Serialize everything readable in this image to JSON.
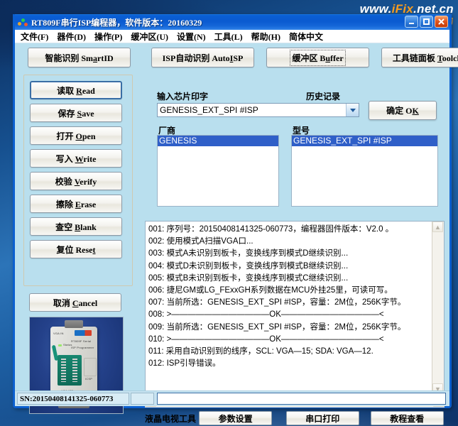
{
  "watermark": {
    "line1_pre": "www.",
    "line1_hl": "iFix",
    "line1_post": ".net.cn",
    "line2": "爱修．助力"
  },
  "window": {
    "title": "RT809F串行ISP编程器，软件版本：20160329",
    "buttons": {
      "minimize": "minimize-icon",
      "maximize": "maximize-icon",
      "close": "close-icon"
    }
  },
  "menu": [
    {
      "label": "文件(F)"
    },
    {
      "label": "器件(D)"
    },
    {
      "label": "操作(P)"
    },
    {
      "label": "缓冲区(U)"
    },
    {
      "label": "设置(N)"
    },
    {
      "label": "工具(L)"
    },
    {
      "label": "帮助(H)"
    },
    {
      "label": "简体中文"
    }
  ],
  "toolbar": [
    {
      "cn": "智能识别 Sm",
      "mn": "a",
      "post": "rtID"
    },
    {
      "cn": "ISP自动识别 Auto",
      "mn": "I",
      "post": "SP"
    },
    {
      "cn": "缓冲区 B",
      "mn": "u",
      "post": "ffer",
      "focused": true
    },
    {
      "cn": "工具链面板 ",
      "mn": "T",
      "post": "oolchain"
    }
  ],
  "left_buttons": [
    {
      "cn": "读取 ",
      "mn": "R",
      "post": "ead",
      "default": true
    },
    {
      "cn": "保存 ",
      "mn": "S",
      "post": "ave"
    },
    {
      "cn": "打开 ",
      "mn": "O",
      "post": "pen"
    },
    {
      "cn": "写入 ",
      "mn": "W",
      "post": "rite"
    },
    {
      "cn": "校验 ",
      "mn": "V",
      "post": "erify"
    },
    {
      "cn": "擦除 ",
      "mn": "E",
      "post": "rase"
    },
    {
      "cn": "查空 ",
      "mn": "B",
      "post": "lank"
    },
    {
      "cn": "复位 Rese",
      "mn": "t",
      "post": ""
    }
  ],
  "cancel_button": {
    "cn": "取消 ",
    "mn": "C",
    "post": "ancel"
  },
  "device_photo": {
    "label_vga_in": "VGA IN",
    "label_vga_isp": "VGA ISP",
    "label_status": "Status",
    "label_model1": "RT809F Serial",
    "label_model2": "ISP Programmer",
    "label_icsp": "ICSP"
  },
  "chip_input": {
    "label": "输入芯片印字",
    "history_label": "历史记录",
    "value": "GENESIS_EXT_SPI #ISP",
    "placeholder": "输入芯片印字"
  },
  "ok_button": {
    "cn": "确定 O",
    "mn": "K",
    "post": ""
  },
  "vendor_list": {
    "label": "厂商",
    "items": [
      {
        "text": "GENESIS",
        "selected": true
      }
    ]
  },
  "model_list": {
    "label": "型号",
    "items": [
      {
        "text": "GENESIS_EXT_SPI #ISP",
        "selected": true
      }
    ]
  },
  "log": {
    "lines": [
      "001: 序列号：20150408141325-060773，编程器固件版本：V2.0 。",
      "002: 使用模式A扫描VGA口...",
      "003: 模式A未识别到板卡，变换线序到模式D继续识别...",
      "004: 模式D未识别到板卡，变换线序到模式B继续识别...",
      "005: 模式B未识别到板卡，变换线序到模式C继续识别...",
      "006: 捷尼GM或LG_FExxGH系列数据在MCU外挂25里，可读可写。",
      "007: 当前所选：GENESIS_EXT_SPI #ISP，容量：2M位，256K字节。",
      "008: >————————————OK————————————<",
      "009: 当前所选：GENESIS_EXT_SPI #ISP，容量：2M位，256K字节。",
      "010: >————————————OK————————————<",
      "011: 采用自动识别到的线序，SCL: VGA—15; SDA: VGA—12.",
      "012: ISP引导错误。"
    ]
  },
  "bottom_bar": {
    "label": "液晶电视工具",
    "buttons": [
      {
        "label": "参数设置"
      },
      {
        "label": "串口打印"
      },
      {
        "label": "教程查看"
      }
    ]
  },
  "statusbar": {
    "sn": "SN:20150408141325-060773",
    "pane2": "",
    "input_value": "",
    "input_placeholder": ""
  }
}
